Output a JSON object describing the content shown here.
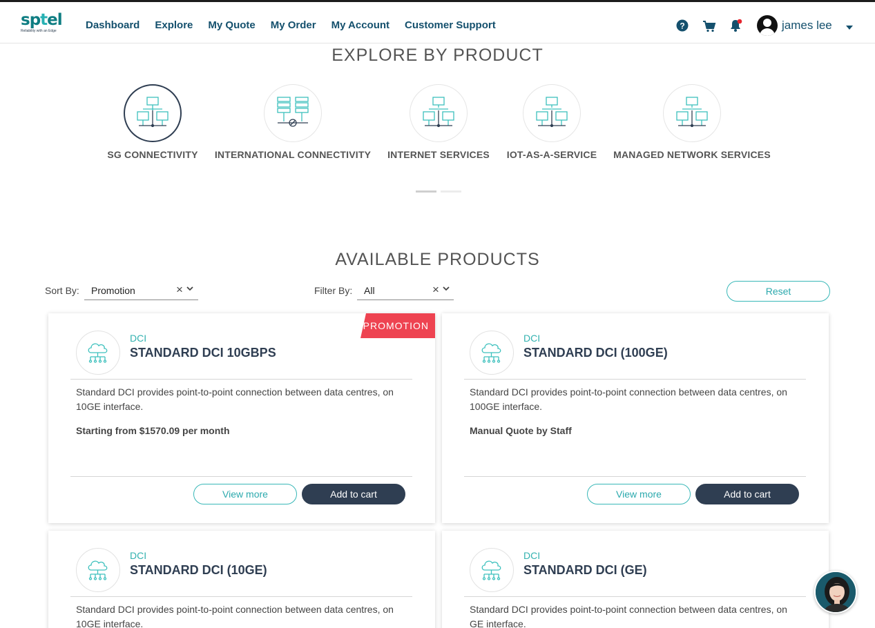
{
  "brand": {
    "name_a": "sp",
    "name_b": "t",
    "name_c": "el",
    "tagline": "Reliability with an Edge"
  },
  "nav": [
    "Dashboard",
    "Explore",
    "My Quote",
    "My Order",
    "My Account",
    "Customer Support"
  ],
  "user": {
    "name": "james lee"
  },
  "explore": {
    "title": "EXPLORE BY PRODUCT",
    "categories": [
      {
        "label": "SG CONNECTIVITY",
        "icon": "network-icon",
        "active": true
      },
      {
        "label": "INTERNATIONAL CONNECTIVITY",
        "icon": "server-network-icon",
        "active": false
      },
      {
        "label": "INTERNET SERVICES",
        "icon": "network-icon",
        "active": false
      },
      {
        "label": "IOT-AS-A-SERVICE",
        "icon": "network-icon",
        "active": false
      },
      {
        "label": "MANAGED NETWORK SERVICES",
        "icon": "network-icon",
        "active": false
      }
    ]
  },
  "products": {
    "title": "AVAILABLE PRODUCTS",
    "sort": {
      "label": "Sort By:",
      "value": "Promotion"
    },
    "filter": {
      "label": "Filter By:",
      "value": "All"
    },
    "reset_label": "Reset",
    "view_more_label": "View more",
    "add_to_cart_label": "Add to cart",
    "promo_label": "PROMOTION",
    "cards": [
      {
        "category": "DCI",
        "title": "STANDARD DCI 10GBPS",
        "desc": "Standard DCI provides point-to-point connection between data centres, on 10GE interface.",
        "price": "Starting from $1570.09 per month",
        "promotion": true
      },
      {
        "category": "DCI",
        "title": "STANDARD DCI (100GE)",
        "desc": "Standard DCI provides point-to-point connection between data centres, on 100GE interface.",
        "price": "Manual Quote by Staff",
        "promotion": false
      },
      {
        "category": "DCI",
        "title": "STANDARD DCI (10GE)",
        "desc": "Standard DCI provides point-to-point connection between data centres, on 10GE interface.",
        "price": "",
        "promotion": false
      },
      {
        "category": "DCI",
        "title": "STANDARD DCI (GE)",
        "desc": "Standard DCI provides point-to-point connection between data centres, on GE interface.",
        "price": "",
        "promotion": false
      }
    ]
  },
  "colors": {
    "teal": "#33b2b0",
    "navy": "#2f3e52",
    "promo": "#ee4351",
    "nav": "#14506d"
  }
}
